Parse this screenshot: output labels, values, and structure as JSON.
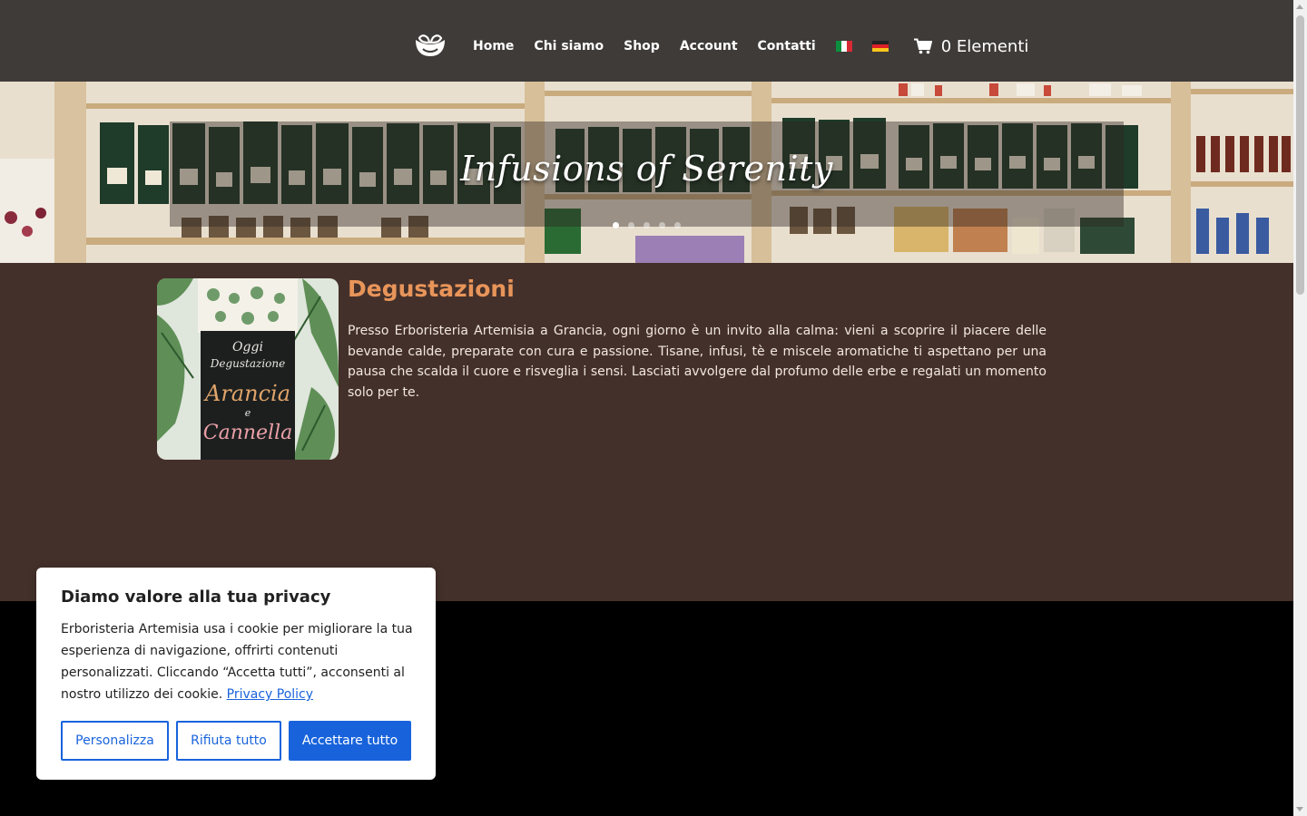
{
  "nav": {
    "items": [
      {
        "label": "Home"
      },
      {
        "label": "Chi siamo"
      },
      {
        "label": "Shop"
      },
      {
        "label": "Account"
      },
      {
        "label": "Contatti"
      }
    ],
    "cart_label": "0 Elementi"
  },
  "hero": {
    "title": "Infusions of Serenity",
    "slide_count": 5,
    "active_slide": 1
  },
  "content": {
    "title": "Degustazioni",
    "image_sign_lines": [
      "Oggi",
      "Degustazione",
      "Arancia",
      "e",
      "Cannella"
    ],
    "body": "Presso Erboristeria Artemisia a Grancia, ogni giorno è un invito alla calma: vieni a scoprire il piacere delle bevande calde, preparate con cura e passione. Tisane, infusi, tè e miscele aromatiche ti aspettano per una pausa che scalda il cuore e risveglia i sensi. Lasciati avvolgere dal profumo delle erbe e regalati un momento solo per te."
  },
  "cookie": {
    "title": "Diamo valore alla tua privacy",
    "text": "Erboristeria Artemisia usa i cookie per migliorare la tua esperienza di navigazione, offrirti contenuti personalizzati. Cliccando “Accetta tutti”, acconsenti al nostro utilizzo dei cookie.",
    "link": "Privacy Policy",
    "buttons": {
      "customize": "Personalizza",
      "reject": "Rifiuta tutto",
      "accept": "Accettare tutto"
    }
  },
  "colors": {
    "header_bg": "#3f3b39",
    "content_bg": "#44302a",
    "accent": "#e8955a",
    "cookie_primary": "#1863dc"
  },
  "icons": [
    "teacup-leaf-logo-icon",
    "italian-flag-icon",
    "german-flag-icon",
    "cart-icon"
  ]
}
